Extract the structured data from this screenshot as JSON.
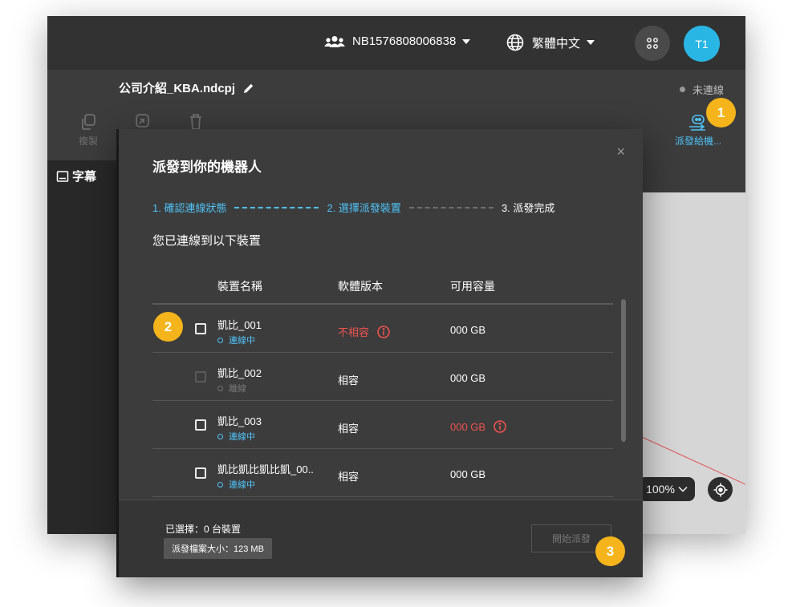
{
  "topbar": {
    "account": "NB1576808006838",
    "language": "繁體中文",
    "avatar": "T1"
  },
  "file": {
    "name": "公司介紹_KBA.ndcpj",
    "status": "未連線"
  },
  "toolbar": {
    "copy_label": "複製",
    "dispatch_label": "派發給機..."
  },
  "left_tab": "字幕",
  "zoom": "100%",
  "modal": {
    "title": "派發到你的機器人",
    "close": "×",
    "steps": [
      "1. 確認連線狀態",
      "2. 選擇派發裝置",
      "3. 派發完成"
    ],
    "subtitle": "您已連線到以下裝置",
    "columns": [
      "裝置名稱",
      "軟體版本",
      "可用容量"
    ],
    "rows": [
      {
        "name": "凱比_001",
        "status": "連線中",
        "version": "不相容",
        "capacity": "000 GB"
      },
      {
        "name": "凱比_002",
        "status": "離線",
        "version": "相容",
        "capacity": "000 GB"
      },
      {
        "name": "凱比_003",
        "status": "連線中",
        "version": "相容",
        "capacity": "000 GB"
      },
      {
        "name": "凱比凱比凱比凱_00..",
        "status": "連線中",
        "version": "相容",
        "capacity": "000 GB"
      }
    ],
    "footer": {
      "selected": "已選擇：0 台裝置",
      "file_size": "派發檔案大小：123 MB",
      "start_button": "開始派發"
    }
  },
  "badges": [
    "1",
    "2",
    "3"
  ],
  "colors": {
    "accent": "#4fc3f7",
    "error": "#ef5350",
    "badge": "#f5b41b",
    "avatar": "#29b6e4"
  }
}
